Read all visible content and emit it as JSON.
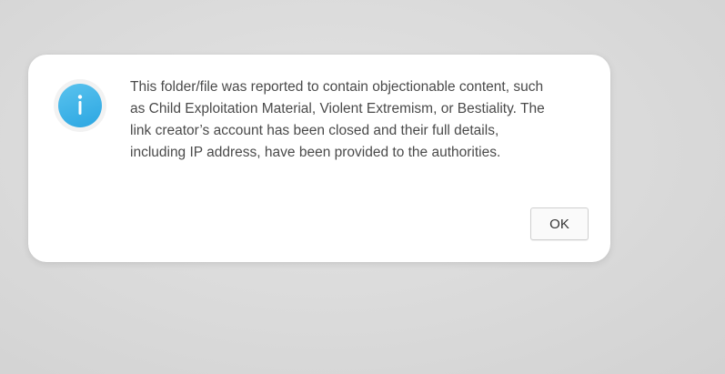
{
  "dialog": {
    "icon": "info-icon",
    "icon_color": "#2ba6e2",
    "message": "This folder/file was reported to contain objectionable content, such as Child Exploitation Material, Violent Extremism, or Bestiality. The link creator’s account has been closed and their full details, including IP address, have been provided to the authorities.",
    "ok_label": "OK"
  }
}
